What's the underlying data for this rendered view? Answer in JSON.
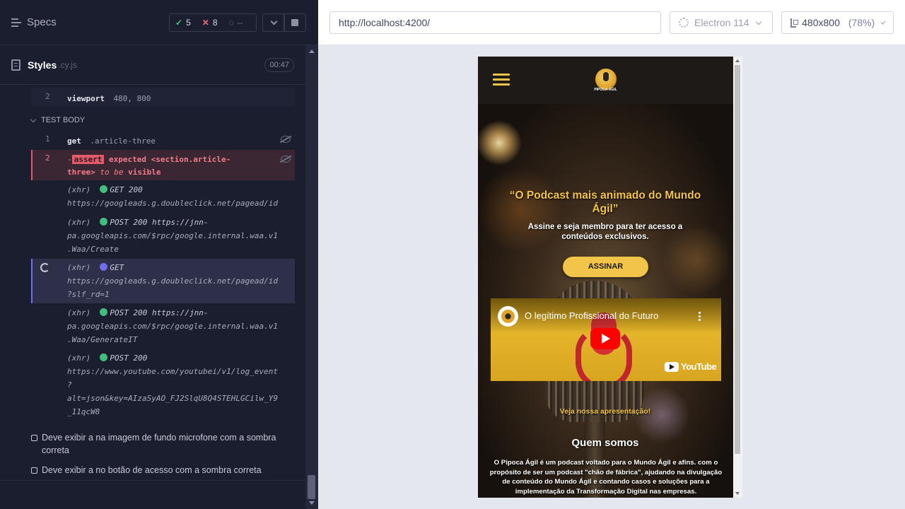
{
  "reporter": {
    "header": {
      "specs_label": "Specs",
      "passed": "5",
      "failed": "8",
      "pending": "--"
    },
    "spec": {
      "name": "Styles",
      "ext": ".cy.js",
      "duration": "00:47"
    },
    "commands": {
      "viewport": {
        "num": "2",
        "name": "viewport",
        "msg": "480, 800"
      },
      "section": "TEST BODY",
      "get": {
        "num": "1",
        "name": "get",
        "msg": ".article-three"
      },
      "assert": {
        "num": "2",
        "badge": "assert",
        "expected": "expected",
        "selector_a": "<section.article-",
        "selector_b": "three>",
        "to_be": "to be",
        "visible": "visible"
      },
      "xhr": [
        {
          "l1": "(xhr)",
          "method": "GET 200",
          "l2": "https://googleads.g.doubleclick.net/pagead/id",
          "l3": "",
          "l4": "",
          "l5": ""
        },
        {
          "l1": "(xhr)",
          "method": "POST 200 https://jnn-",
          "l2": "pa.googleapis.com/$rpc/google.internal.waa.v1",
          "l3": ".Waa/Create",
          "l4": "",
          "l5": ""
        },
        {
          "l1": "(xhr)",
          "method": "GET",
          "l2": "https://googleads.g.doubleclick.net/pagead/id",
          "l3": "?slf_rd=1",
          "l4": "",
          "l5": ""
        },
        {
          "l1": "(xhr)",
          "method": "POST 200 https://jnn-",
          "l2": "pa.googleapis.com/$rpc/google.internal.waa.v1",
          "l3": ".Waa/GenerateIT",
          "l4": "",
          "l5": ""
        },
        {
          "l1": "(xhr)",
          "method": "POST 200",
          "l2": "https://www.youtube.com/youtubei/v1/log_event",
          "l3": "?",
          "l4": "alt=json&key=AIzaSyAO_FJ2SlqU8Q4STEHLGCilw_Y9",
          "l5": "_11qcW8"
        }
      ]
    },
    "tests": [
      "Deve exibir a na imagem de fundo microfone com a sombra correta",
      "Deve exibir a no botão de acesso com a sombra correta"
    ]
  },
  "browser": {
    "url": "http://localhost:4200/",
    "browser_name": "Electron 114",
    "viewport": "480x800",
    "scale": "(78%)"
  },
  "site": {
    "logo_text": "PIPOCA ÁGIL",
    "hero_title": "“O Podcast mais animado do Mundo Ágil”",
    "hero_subtitle": "Assine e seja membro para ter acesso a conteúdos exclusivos.",
    "cta_label": "ASSINAR",
    "video_title": "O legítimo Profissional do Futuro",
    "youtube_label": "YouTube",
    "watch_link": "Veja nossa apresentação!",
    "about_title": "Quem somos",
    "about_text": "O Pipoca Ágil é um podcast voltado para o Mundo Ágil e afins. com o propósito de ser um podcast \"chão de fábrica\", ajudando na divulgação de conteúdo do Mundo Ágil e contando casos e soluções para a implementação da Transformação Digital nas empresas."
  },
  "colors": {
    "reporter_bg": "#1b1e2e",
    "accent_yellow": "#f3c44a",
    "pass_green": "#4ac38b",
    "fail_red": "#f06b78",
    "active_blue": "#6e6ff0"
  }
}
